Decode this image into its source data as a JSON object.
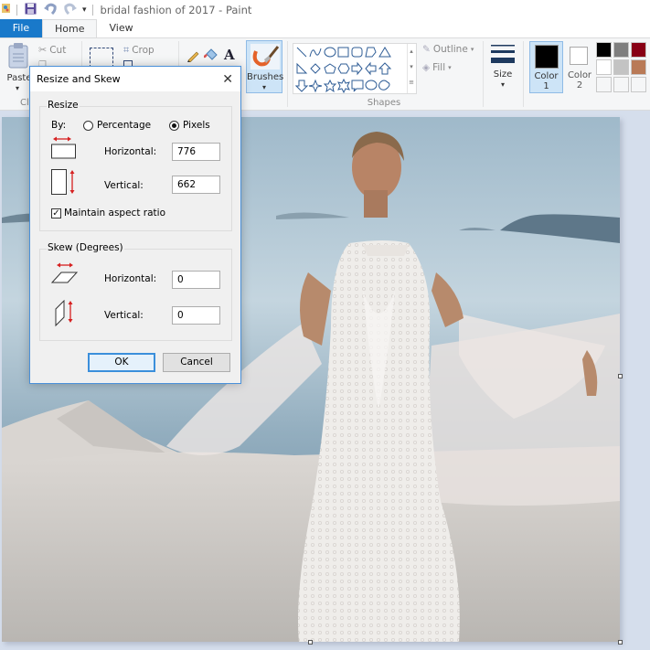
{
  "window": {
    "title": "bridal fashion of 2017 - Paint"
  },
  "quick_access": {
    "icons": [
      "paint-app-icon",
      "save-icon",
      "undo-icon",
      "redo-icon",
      "customize-dropdown-icon"
    ]
  },
  "tabs": [
    {
      "label": "File",
      "active": false
    },
    {
      "label": "Home",
      "active": true
    },
    {
      "label": "View",
      "active": false
    }
  ],
  "ribbon": {
    "clipboard": {
      "paste": "Paste",
      "cut": "Cut",
      "group_label": "Cl"
    },
    "image": {
      "crop": "Crop"
    },
    "brushes": {
      "label": "Brushes"
    },
    "shapes": {
      "outline": "Outline",
      "fill": "Fill",
      "group_label": "Shapes"
    },
    "size": {
      "label": "Size"
    },
    "color1": {
      "label_line1": "Color",
      "label_line2": "1",
      "color": "#000000"
    },
    "color2": {
      "label_line1": "Color",
      "label_line2": "2",
      "color": "#ffffff"
    },
    "palette": [
      "#000000",
      "#7f7f7f",
      "#880015",
      "#ffffff",
      "#c3c3c3",
      "#b97a57",
      "#f5f6f7",
      "#f5f6f7",
      "#f5f6f7"
    ]
  },
  "dialog": {
    "title": "Resize and Skew",
    "resize": {
      "legend": "Resize",
      "by_label": "By:",
      "option_percentage": "Percentage",
      "option_pixels": "Pixels",
      "selected": "Pixels",
      "horizontal_label": "Horizontal:",
      "horizontal_value": "776",
      "vertical_label": "Vertical:",
      "vertical_value": "662",
      "maintain_aspect_label": "Maintain aspect ratio",
      "maintain_aspect_checked": true
    },
    "skew": {
      "legend": "Skew (Degrees)",
      "horizontal_label": "Horizontal:",
      "horizontal_value": "0",
      "vertical_label": "Vertical:",
      "vertical_value": "0"
    },
    "ok_label": "OK",
    "cancel_label": "Cancel"
  },
  "canvas": {
    "image_description": "Bride in white lace halter gown with sheer bell sleeves on a white terrace overlooking the sea"
  }
}
